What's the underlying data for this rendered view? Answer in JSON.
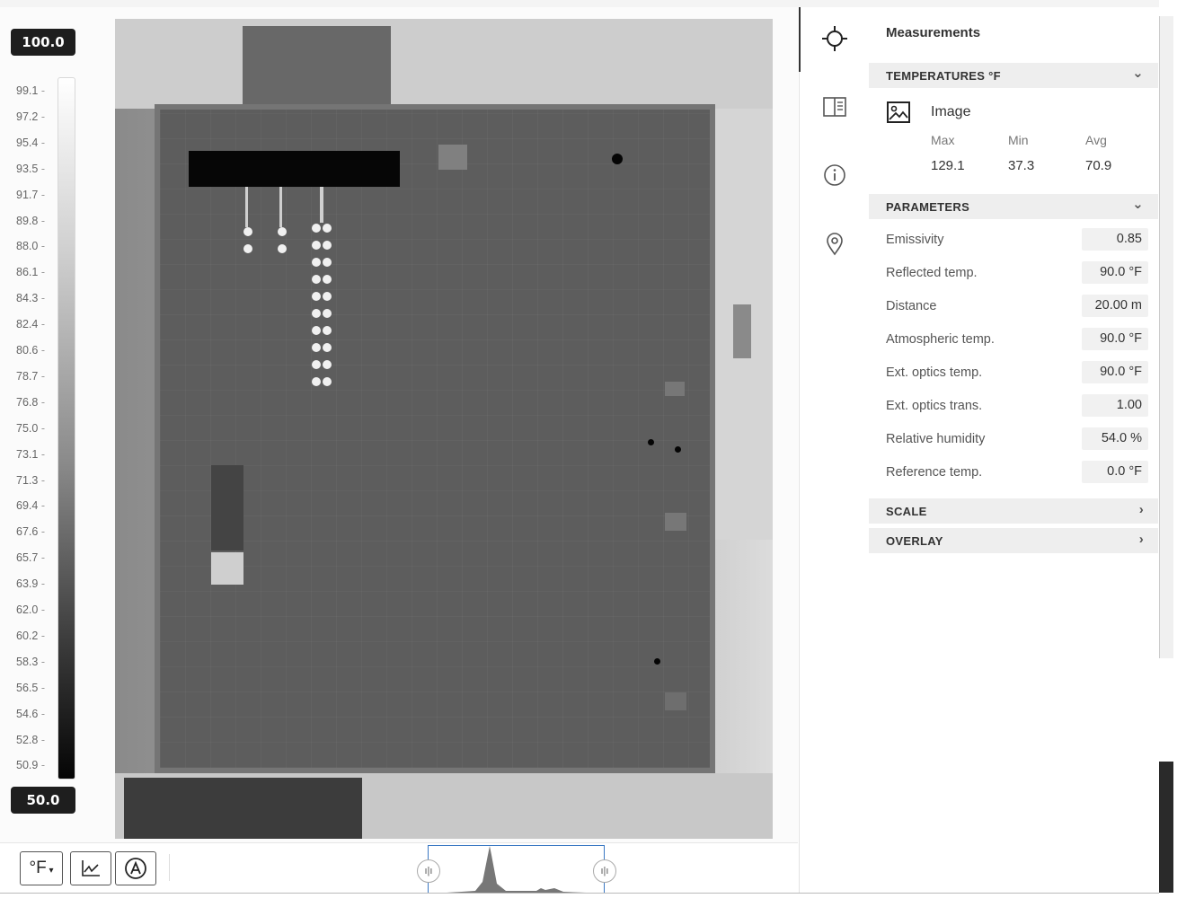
{
  "scale": {
    "max_value": "100.0",
    "min_value": "50.0",
    "ticks": [
      "99.1",
      "97.2",
      "95.4",
      "93.5",
      "91.7",
      "89.8",
      "88.0",
      "86.1",
      "84.3",
      "82.4",
      "80.6",
      "78.7",
      "76.8",
      "75.0",
      "73.1",
      "71.3",
      "69.4",
      "67.6",
      "65.7",
      "63.9",
      "62.0",
      "60.2",
      "58.3",
      "56.5",
      "54.6",
      "52.8",
      "50.9"
    ]
  },
  "toolbar": {
    "unit_label": "°F"
  },
  "panel": {
    "title": "Measurements",
    "temperatures": {
      "header": "TEMPERATURES °F",
      "source_label": "Image",
      "max_label": "Max",
      "min_label": "Min",
      "avg_label": "Avg",
      "max_value": "129.1",
      "min_value": "37.3",
      "avg_value": "70.9"
    },
    "parameters": {
      "header": "PARAMETERS",
      "rows": [
        {
          "label": "Emissivity",
          "value": "0.85"
        },
        {
          "label": "Reflected temp.",
          "value": "90.0 °F"
        },
        {
          "label": "Distance",
          "value": "20.00 m"
        },
        {
          "label": "Atmospheric temp.",
          "value": "90.0 °F"
        },
        {
          "label": "Ext. optics temp.",
          "value": "90.0 °F"
        },
        {
          "label": "Ext. optics trans.",
          "value": "1.00"
        },
        {
          "label": "Relative humidity",
          "value": "54.0 %"
        },
        {
          "label": "Reference temp.",
          "value": "0.0 °F"
        }
      ]
    },
    "scale_header": "SCALE",
    "overlay_header": "OVERLAY"
  },
  "icons": {
    "measure": "crosshair-icon",
    "layout": "panel-layout-icon",
    "info": "info-icon",
    "location": "location-pin-icon"
  }
}
